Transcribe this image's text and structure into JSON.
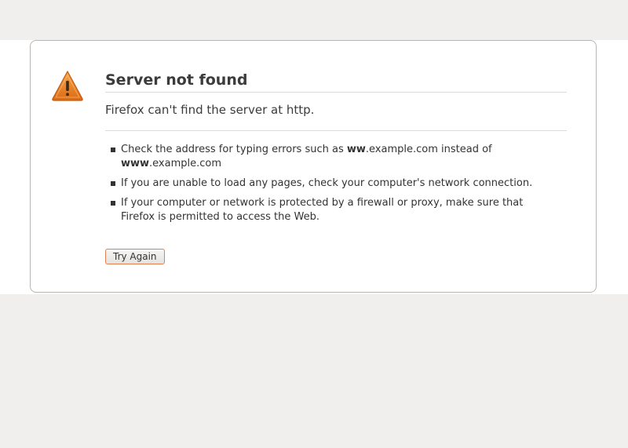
{
  "error": {
    "title": "Server not found",
    "message": "Firefox can't find the server at http.",
    "suggestions": {
      "item1_pre": "Check the address for typing errors such as ",
      "item1_bold1": "ww",
      "item1_mid": ".example.com instead of",
      "item1_bold2": "www",
      "item1_post": ".example.com",
      "item2": "If you are unable to load any pages, check your computer's network connection.",
      "item3": "If your computer or network is protected by a firewall or proxy, make sure that Firefox is permitted to access the Web."
    },
    "button_label": "Try Again",
    "icon": "warning-triangle-icon"
  },
  "colors": {
    "icon_orange": "#e8821e",
    "button_border": "#e08050",
    "background": "#f0efee"
  }
}
